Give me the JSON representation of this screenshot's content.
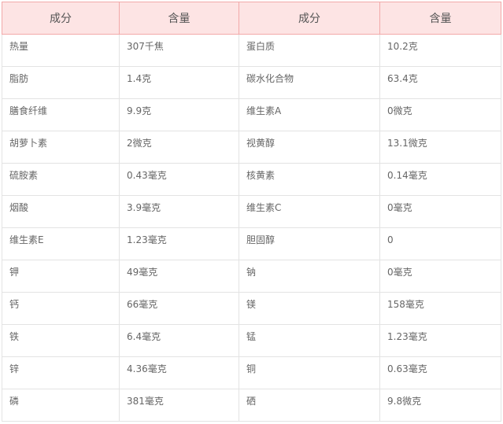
{
  "table": {
    "headers": [
      "成分",
      "含量",
      "成分",
      "含量"
    ],
    "rows": [
      [
        "热量",
        "307千焦",
        "蛋白质",
        "10.2克"
      ],
      [
        "脂肪",
        "1.4克",
        "碳水化合物",
        "63.4克"
      ],
      [
        "膳食纤维",
        "9.9克",
        "维生素A",
        "0微克"
      ],
      [
        "胡萝卜素",
        "2微克",
        "视黄醇",
        "13.1微克"
      ],
      [
        "硫胺素",
        "0.43毫克",
        "核黄素",
        "0.14毫克"
      ],
      [
        "烟酸",
        "3.9毫克",
        "维生素C",
        "0毫克"
      ],
      [
        "维生素E",
        "1.23毫克",
        "胆固醇",
        "0"
      ],
      [
        "钾",
        "49毫克",
        "钠",
        "0毫克"
      ],
      [
        "钙",
        "66毫克",
        "镁",
        "158毫克"
      ],
      [
        "铁",
        "6.4毫克",
        "锰",
        "1.23毫克"
      ],
      [
        "锌",
        "4.36毫克",
        "铜",
        "0.63毫克"
      ],
      [
        "磷",
        "381毫克",
        "硒",
        "9.8微克"
      ]
    ]
  },
  "colors": {
    "header_bg": "#fde4e4",
    "header_border": "#f2a9a9",
    "cell_border": "#e3e3e3",
    "text": "#666666"
  }
}
